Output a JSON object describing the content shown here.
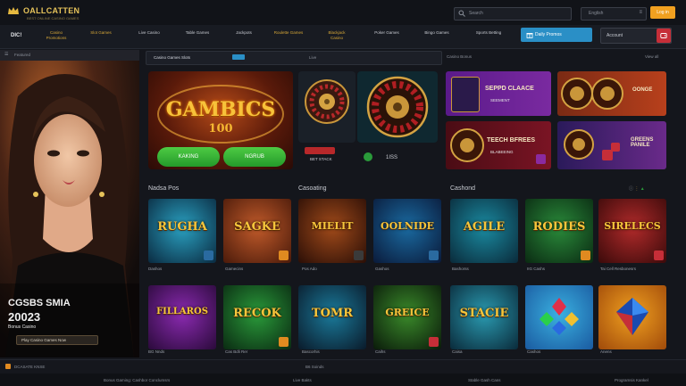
{
  "header": {
    "logo_text": "OALLCATTEN",
    "logo_sub": "BEST ONLINE CASINO GAMES",
    "search_placeholder": "Search",
    "lang_label": "English",
    "login_label": "Log in"
  },
  "nav": {
    "brand": "DIC!",
    "items": [
      "Casino Promotions",
      "Slot Games",
      "Live Casino",
      "Table Games",
      "Jackpots",
      "Roulette Games",
      "Blackjack Casino",
      "Poker Games",
      "Bingo Games",
      "Sports Betting"
    ],
    "promo_label": "Daily Promos",
    "account_label": "Account"
  },
  "sidebar": {
    "top_label": "Featured",
    "hero_line1": "CGSBS SMIA",
    "hero_line2": "20023",
    "hero_line3": "Bonus Casino",
    "hero_button": "Play Casino Games Now"
  },
  "tabs": {
    "items": [
      "Casino Games Slots",
      "Live",
      "Casino Bonus"
    ]
  },
  "banner": {
    "title": "GAMBICS",
    "subtitle": "100",
    "btn_left": "KAKING",
    "btn_right": "NGRUB"
  },
  "roulette": {
    "chip_label": "BET STACK",
    "count_label": "1ISS"
  },
  "promos": [
    {
      "title": "SEPPD CLAACE",
      "sub": "SEEMENT"
    },
    {
      "title": "OONGE",
      "sub": ""
    },
    {
      "title": "TEECH BFREES",
      "sub": "BLABEEING"
    },
    {
      "title": "GREENS PANILE",
      "sub": ""
    }
  ],
  "sections": {
    "left": "Nadsa Pos",
    "mid": "Casoating",
    "right": "Cashond",
    "right_link": "View all"
  },
  "games_row1": [
    {
      "title": "RUGHA",
      "caption": "Dashos"
    },
    {
      "title": "SAGKE",
      "caption": "Gamecins"
    },
    {
      "title": "MIELIT",
      "caption": "Pos Ado"
    },
    {
      "title": "OOLNIDE",
      "caption": "Gashos"
    },
    {
      "title": "AGILE",
      "caption": "Bashorss"
    },
    {
      "title": "RODIES",
      "caption": "IIG Cashs"
    },
    {
      "title": "SIRELECS",
      "caption": "Tai Cell Resbonesrs"
    }
  ],
  "games_row2": [
    {
      "title": "FILLAROS",
      "caption": "BG Nnds"
    },
    {
      "title": "RECOK",
      "caption": "Cas Bdli Rer"
    },
    {
      "title": "TOMR",
      "caption": "Bascorhis"
    },
    {
      "title": "GREICE",
      "caption": "Caihs"
    },
    {
      "title": "STACIE",
      "caption": "Caisa"
    },
    {
      "title": "",
      "caption": "Cashos"
    },
    {
      "title": "",
      "caption": "Anens"
    }
  ],
  "footer": {
    "left": "DCASATE KNSE",
    "mid": "B6 Soinds",
    "bottom1": "Bonus Gaming: Cashbor Conclumsrs",
    "bottom2": "Live Bakts",
    "bottom3": "Stable Gash Cans",
    "bottom4": "Programsis Kankel"
  },
  "colors": {
    "accent": "#f0a020",
    "promo_blue": "#2a8fc6",
    "gold": "#f6c63c"
  }
}
